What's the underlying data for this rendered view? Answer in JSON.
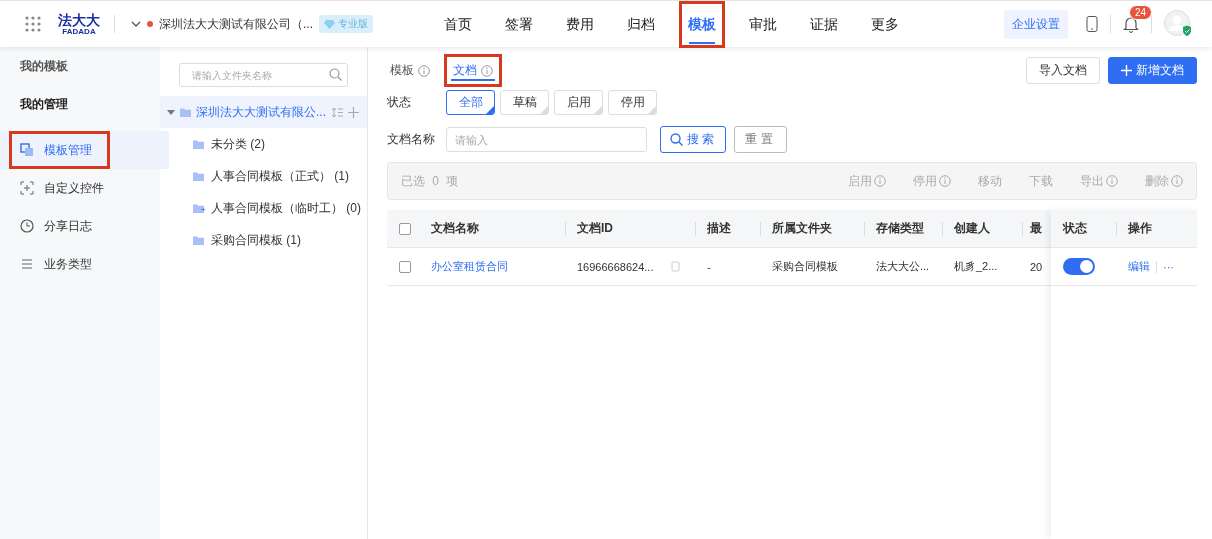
{
  "topbar": {
    "logo": "法大大",
    "logo_sub": "FADADA",
    "company": "深圳法大大测试有限公司（...",
    "edition": "专业版",
    "nav": [
      {
        "label": "首页",
        "selected": false,
        "highlighted": false
      },
      {
        "label": "签署",
        "selected": false,
        "highlighted": false
      },
      {
        "label": "费用",
        "selected": false,
        "highlighted": false
      },
      {
        "label": "归档",
        "selected": false,
        "highlighted": false
      },
      {
        "label": "模板",
        "selected": true,
        "highlighted": true
      },
      {
        "label": "审批",
        "selected": false,
        "highlighted": false
      },
      {
        "label": "证据",
        "selected": false,
        "highlighted": false
      },
      {
        "label": "更多",
        "selected": false,
        "highlighted": false
      }
    ],
    "settings": "企业设置",
    "notification_count": "24"
  },
  "sidebar": {
    "items": [
      {
        "kind": "heading",
        "label": "我的模板"
      },
      {
        "kind": "heading",
        "label": "我的管理"
      },
      {
        "kind": "item",
        "label": "模板管理",
        "selected": true,
        "highlighted": true
      },
      {
        "kind": "item",
        "label": "自定义控件",
        "selected": false,
        "highlighted": false
      },
      {
        "kind": "item",
        "label": "分享日志",
        "selected": false,
        "highlighted": false
      },
      {
        "kind": "item",
        "label": "业务类型",
        "selected": false,
        "highlighted": false
      }
    ]
  },
  "folders": {
    "placeholder": "请输入文件夹名称",
    "tree": [
      {
        "label": "深圳法大大测试有限公...",
        "expanded": true,
        "selected": true,
        "children": [
          {
            "label": "未分类 (2)",
            "shared": false
          },
          {
            "label": "人事合同模板（正式） (1)",
            "shared": false
          },
          {
            "label": "人事合同模板（临时工） (0)",
            "shared": true
          },
          {
            "label": "采购合同模板 (1)",
            "shared": false
          }
        ]
      }
    ]
  },
  "main": {
    "tabs": [
      {
        "label": "模板",
        "selected": false,
        "highlighted": false
      },
      {
        "label": "文档",
        "selected": true,
        "highlighted": true
      }
    ],
    "buttons": [
      {
        "label": "导入文档",
        "kind": "secondary"
      },
      {
        "label": "新增文档",
        "kind": "primary"
      }
    ],
    "status_filter": {
      "label": "状态",
      "options": [
        {
          "label": "全部",
          "selected": true
        },
        {
          "label": "草稿",
          "selected": false
        },
        {
          "label": "启用",
          "selected": false
        },
        {
          "label": "停用",
          "selected": false
        }
      ]
    },
    "name_filter": {
      "label": "文档名称",
      "placeholder": "请输入",
      "search": "搜索",
      "reset": "重置"
    },
    "batch": {
      "selected_text": "已选 0 项",
      "actions": [
        {
          "label": "启用",
          "info": true
        },
        {
          "label": "停用",
          "info": true
        },
        {
          "label": "移动",
          "info": false
        },
        {
          "label": "下载",
          "info": false
        },
        {
          "label": "导出",
          "info": true
        },
        {
          "label": "删除",
          "info": true
        }
      ]
    },
    "table": {
      "all_checked": false,
      "columns": [
        "文档名称",
        "文档ID",
        "描述",
        "所属文件夹",
        "存储类型",
        "创建人",
        "最",
        "状态",
        "操作"
      ],
      "rows": [
        {
          "checked": false,
          "name": "办公室租赁合同",
          "id": "16966668624...",
          "description": "-",
          "folder": "采购合同模板",
          "storage": "法大大公...",
          "creator": "机豸_2...",
          "column_7": "20",
          "enabled": true,
          "actions": [
            "编辑",
            "···"
          ]
        }
      ]
    }
  }
}
